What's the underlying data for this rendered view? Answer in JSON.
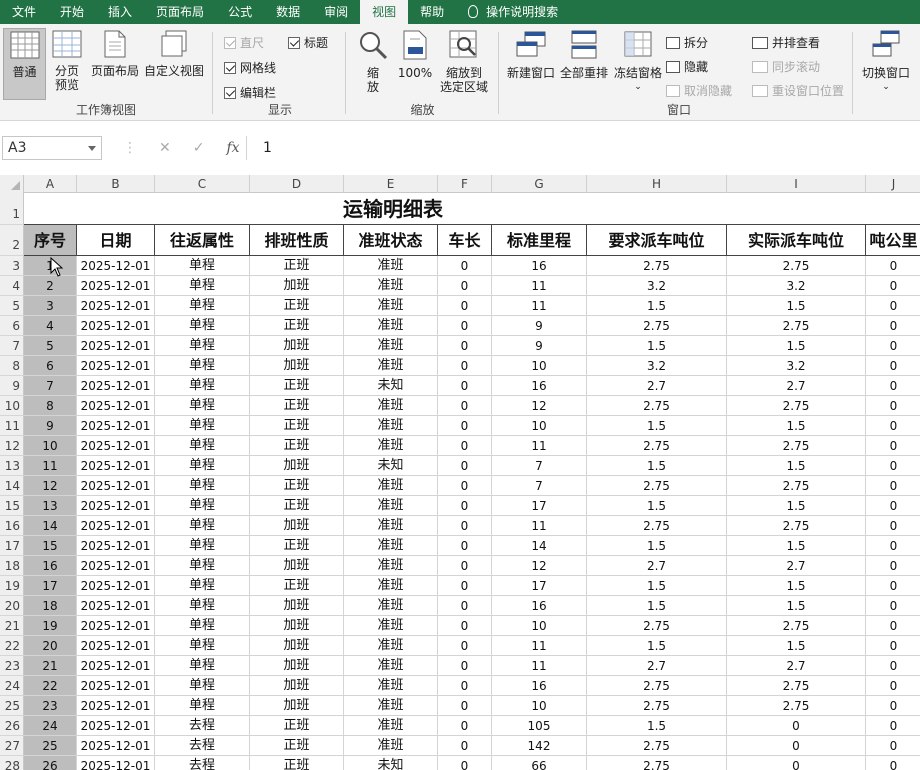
{
  "tabs": [
    "文件",
    "开始",
    "插入",
    "页面布局",
    "公式",
    "数据",
    "审阅",
    "视图",
    "帮助",
    "操作说明搜索"
  ],
  "active_tab": "视图",
  "ribbon": {
    "workbook_views": {
      "label": "工作簿视图",
      "normal": "普通",
      "page_break_line1": "分页",
      "page_break_line2": "预览",
      "page_layout": "页面布局",
      "custom_view": "自定义视图"
    },
    "show": {
      "label": "显示",
      "ruler": "直尺",
      "gridlines": "网格线",
      "formula_bar": "编辑栏",
      "headings": "标题"
    },
    "zoom": {
      "label": "缩放",
      "zoom_line1": "缩",
      "zoom_line2": "放",
      "hundred": "100%",
      "zoom_sel_line1": "缩放到",
      "zoom_sel_line2": "选定区域"
    },
    "window": {
      "label": "窗口",
      "new_window": "新建窗口",
      "arrange_all": "全部重排",
      "freeze_panes": "冻结窗格",
      "split": "拆分",
      "hide": "隐藏",
      "unhide": "取消隐藏",
      "side_by_side": "并排查看",
      "sync_scroll": "同步滚动",
      "reset_pos": "重设窗口位置",
      "switch_window": "切换窗口"
    }
  },
  "formula_bar": {
    "name_box": "A3",
    "value": "1",
    "fx": "fx"
  },
  "columns": [
    "A",
    "B",
    "C",
    "D",
    "E",
    "F",
    "G",
    "H",
    "I",
    "J"
  ],
  "sheet_title": "运输明细表",
  "headers": [
    "序号",
    "日期",
    "往返属性",
    "排班性质",
    "准班状态",
    "车长",
    "标准里程",
    "要求派车吨位",
    "实际派车吨位",
    "吨公里"
  ],
  "rows": [
    [
      "1",
      "2025-12-01",
      "单程",
      "正班",
      "准班",
      "0",
      "16",
      "2.75",
      "2.75",
      "0"
    ],
    [
      "2",
      "2025-12-01",
      "单程",
      "加班",
      "准班",
      "0",
      "11",
      "3.2",
      "3.2",
      "0"
    ],
    [
      "3",
      "2025-12-01",
      "单程",
      "正班",
      "准班",
      "0",
      "11",
      "1.5",
      "1.5",
      "0"
    ],
    [
      "4",
      "2025-12-01",
      "单程",
      "正班",
      "准班",
      "0",
      "9",
      "2.75",
      "2.75",
      "0"
    ],
    [
      "5",
      "2025-12-01",
      "单程",
      "加班",
      "准班",
      "0",
      "9",
      "1.5",
      "1.5",
      "0"
    ],
    [
      "6",
      "2025-12-01",
      "单程",
      "加班",
      "准班",
      "0",
      "10",
      "3.2",
      "3.2",
      "0"
    ],
    [
      "7",
      "2025-12-01",
      "单程",
      "正班",
      "未知",
      "0",
      "16",
      "2.7",
      "2.7",
      "0"
    ],
    [
      "8",
      "2025-12-01",
      "单程",
      "正班",
      "准班",
      "0",
      "12",
      "2.75",
      "2.75",
      "0"
    ],
    [
      "9",
      "2025-12-01",
      "单程",
      "正班",
      "准班",
      "0",
      "10",
      "1.5",
      "1.5",
      "0"
    ],
    [
      "10",
      "2025-12-01",
      "单程",
      "正班",
      "准班",
      "0",
      "11",
      "2.75",
      "2.75",
      "0"
    ],
    [
      "11",
      "2025-12-01",
      "单程",
      "加班",
      "未知",
      "0",
      "7",
      "1.5",
      "1.5",
      "0"
    ],
    [
      "12",
      "2025-12-01",
      "单程",
      "正班",
      "准班",
      "0",
      "7",
      "2.75",
      "2.75",
      "0"
    ],
    [
      "13",
      "2025-12-01",
      "单程",
      "正班",
      "准班",
      "0",
      "17",
      "1.5",
      "1.5",
      "0"
    ],
    [
      "14",
      "2025-12-01",
      "单程",
      "加班",
      "准班",
      "0",
      "11",
      "2.75",
      "2.75",
      "0"
    ],
    [
      "15",
      "2025-12-01",
      "单程",
      "正班",
      "准班",
      "0",
      "14",
      "1.5",
      "1.5",
      "0"
    ],
    [
      "16",
      "2025-12-01",
      "单程",
      "加班",
      "准班",
      "0",
      "12",
      "2.7",
      "2.7",
      "0"
    ],
    [
      "17",
      "2025-12-01",
      "单程",
      "正班",
      "准班",
      "0",
      "17",
      "1.5",
      "1.5",
      "0"
    ],
    [
      "18",
      "2025-12-01",
      "单程",
      "加班",
      "准班",
      "0",
      "16",
      "1.5",
      "1.5",
      "0"
    ],
    [
      "19",
      "2025-12-01",
      "单程",
      "加班",
      "准班",
      "0",
      "10",
      "2.75",
      "2.75",
      "0"
    ],
    [
      "20",
      "2025-12-01",
      "单程",
      "加班",
      "准班",
      "0",
      "11",
      "1.5",
      "1.5",
      "0"
    ],
    [
      "21",
      "2025-12-01",
      "单程",
      "加班",
      "准班",
      "0",
      "11",
      "2.7",
      "2.7",
      "0"
    ],
    [
      "22",
      "2025-12-01",
      "单程",
      "加班",
      "准班",
      "0",
      "16",
      "2.75",
      "2.75",
      "0"
    ],
    [
      "23",
      "2025-12-01",
      "单程",
      "加班",
      "准班",
      "0",
      "10",
      "2.75",
      "2.75",
      "0"
    ],
    [
      "24",
      "2025-12-01",
      "去程",
      "正班",
      "准班",
      "0",
      "105",
      "1.5",
      "0",
      "0"
    ],
    [
      "25",
      "2025-12-01",
      "去程",
      "正班",
      "准班",
      "0",
      "142",
      "2.75",
      "0",
      "0"
    ],
    [
      "26",
      "2025-12-01",
      "去程",
      "正班",
      "未知",
      "0",
      "66",
      "2.75",
      "0",
      "0"
    ]
  ],
  "row_numbers": [
    "1",
    "2",
    "3",
    "4",
    "5",
    "6",
    "7",
    "8",
    "9",
    "10",
    "11",
    "12",
    "13",
    "14",
    "15",
    "16",
    "17",
    "18",
    "19",
    "20",
    "21",
    "22",
    "23",
    "24",
    "25",
    "26",
    "27",
    "28"
  ]
}
